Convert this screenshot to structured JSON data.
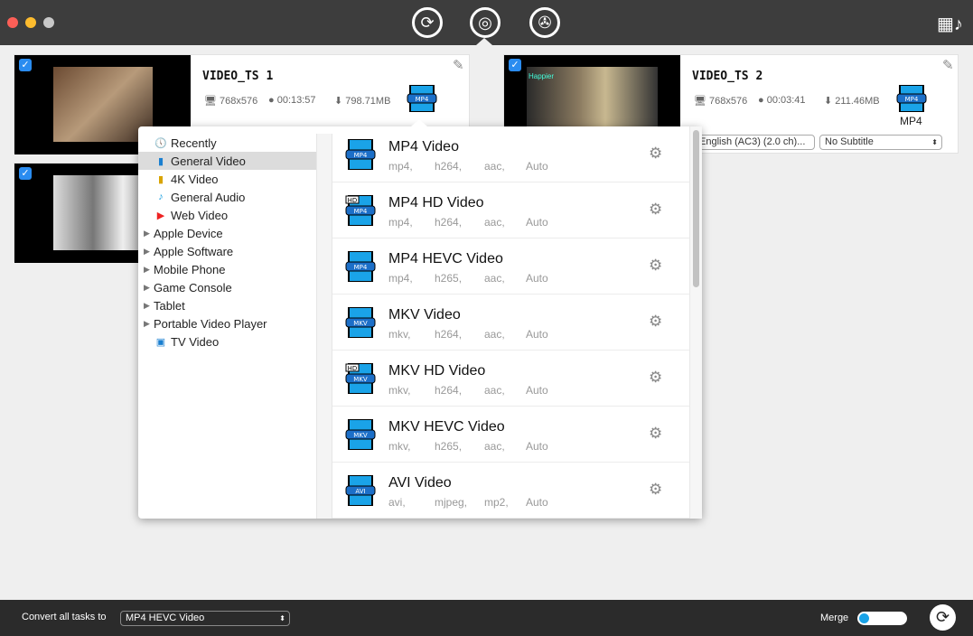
{
  "toolbar": {
    "icons": [
      "convert-icon",
      "dvd-convert-icon",
      "toolbox-icon"
    ],
    "media-icon": "film-music-icon"
  },
  "tasks": [
    {
      "title": "VIDEO_TS 1",
      "resolution": "768x576",
      "duration": "00:13:57",
      "size": "798.71MB",
      "format": "MP4",
      "checked": true
    },
    {
      "title": "VIDEO_TS 2",
      "resolution": "768x576",
      "duration": "00:03:41",
      "size": "211.46MB",
      "format": "MP4",
      "format_badge": "MP4",
      "audio": "English (AC3) (2.0 ch)...",
      "subtitle": "No Subtitle",
      "checked": true
    },
    {
      "checked": true
    }
  ],
  "thumb2_caption": "Happier",
  "categories": [
    {
      "label": "Recently",
      "icon": "clock-icon"
    },
    {
      "label": "General Video",
      "icon": "film-icon",
      "selected": true
    },
    {
      "label": "4K Video",
      "icon": "4k-film-icon"
    },
    {
      "label": "General Audio",
      "icon": "music-note-icon"
    },
    {
      "label": "Web Video",
      "icon": "youtube-icon"
    },
    {
      "label": "Apple Device",
      "expandable": true
    },
    {
      "label": "Apple Software",
      "expandable": true
    },
    {
      "label": "Mobile Phone",
      "expandable": true
    },
    {
      "label": "Game Console",
      "expandable": true
    },
    {
      "label": "Tablet",
      "expandable": true
    },
    {
      "label": "Portable Video Player",
      "expandable": true
    },
    {
      "label": "TV Video",
      "icon": "tv-icon"
    }
  ],
  "formats": [
    {
      "name": "MP4 Video",
      "badge": "MP4",
      "container": "mp4,",
      "video": "h264,",
      "audio": "aac,",
      "res": "Auto"
    },
    {
      "name": "MP4 HD Video",
      "badge": "MP4",
      "hd": true,
      "container": "mp4,",
      "video": "h264,",
      "audio": "aac,",
      "res": "Auto"
    },
    {
      "name": "MP4 HEVC Video",
      "badge": "MP4",
      "container": "mp4,",
      "video": "h265,",
      "audio": "aac,",
      "res": "Auto"
    },
    {
      "name": "MKV Video",
      "badge": "MKV",
      "container": "mkv,",
      "video": "h264,",
      "audio": "aac,",
      "res": "Auto"
    },
    {
      "name": "MKV HD Video",
      "badge": "MKV",
      "hd": true,
      "container": "mkv,",
      "video": "h264,",
      "audio": "aac,",
      "res": "Auto"
    },
    {
      "name": "MKV HEVC Video",
      "badge": "MKV",
      "container": "mkv,",
      "video": "h265,",
      "audio": "aac,",
      "res": "Auto"
    },
    {
      "name": "AVI Video",
      "badge": "AVI",
      "container": "avi,",
      "video": "mjpeg,",
      "audio": "mp2,",
      "res": "Auto"
    }
  ],
  "bottom": {
    "convert_label": "Convert all tasks to",
    "convert_value": "MP4 HEVC Video",
    "merge_label": "Merge",
    "merge_on": false
  },
  "colors": {
    "accent": "#2a8cf0",
    "titlebar": "#3d3d3d",
    "bottombar": "#2b2b2b"
  }
}
